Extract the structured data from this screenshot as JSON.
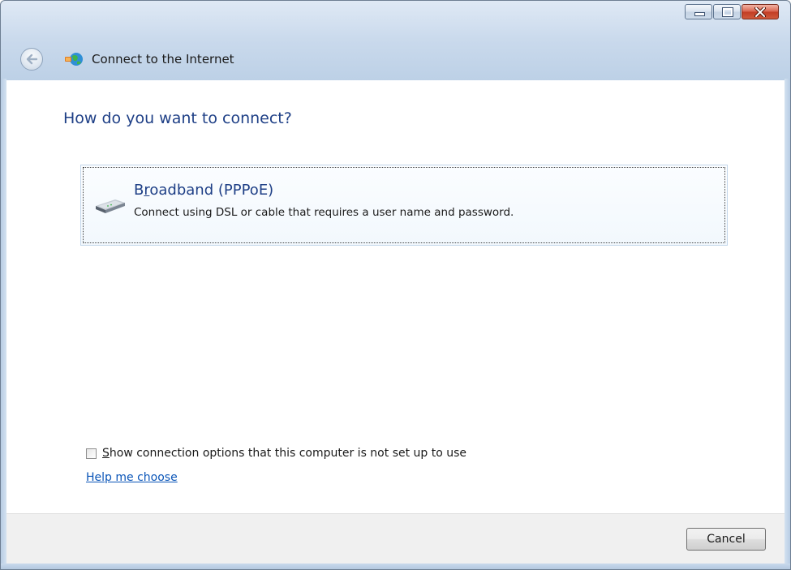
{
  "window": {
    "title": "Connect to the Internet",
    "caption_buttons": [
      "minimize",
      "maximize",
      "close"
    ]
  },
  "nav": {
    "back_icon": "back-arrow-icon",
    "title_icon": "network-globe-icon"
  },
  "main": {
    "heading": "How do you want to connect?",
    "options": [
      {
        "title_prefix": "B",
        "title_accel": "r",
        "title_rest": "oadband (PPPoE)",
        "description": "Connect using DSL or cable that requires a user name and password.",
        "icon": "modem-icon"
      }
    ],
    "show_options_checkbox": {
      "checked": false,
      "label_accel": "S",
      "label_rest": "how connection options that this computer is not set up to use"
    },
    "help_link": "Help me choose"
  },
  "footer": {
    "cancel_label": "Cancel"
  },
  "colors": {
    "heading": "#1e3f86",
    "link": "#0a55b8",
    "close_button": "#c23c24",
    "frame": "#c9d9ec"
  }
}
